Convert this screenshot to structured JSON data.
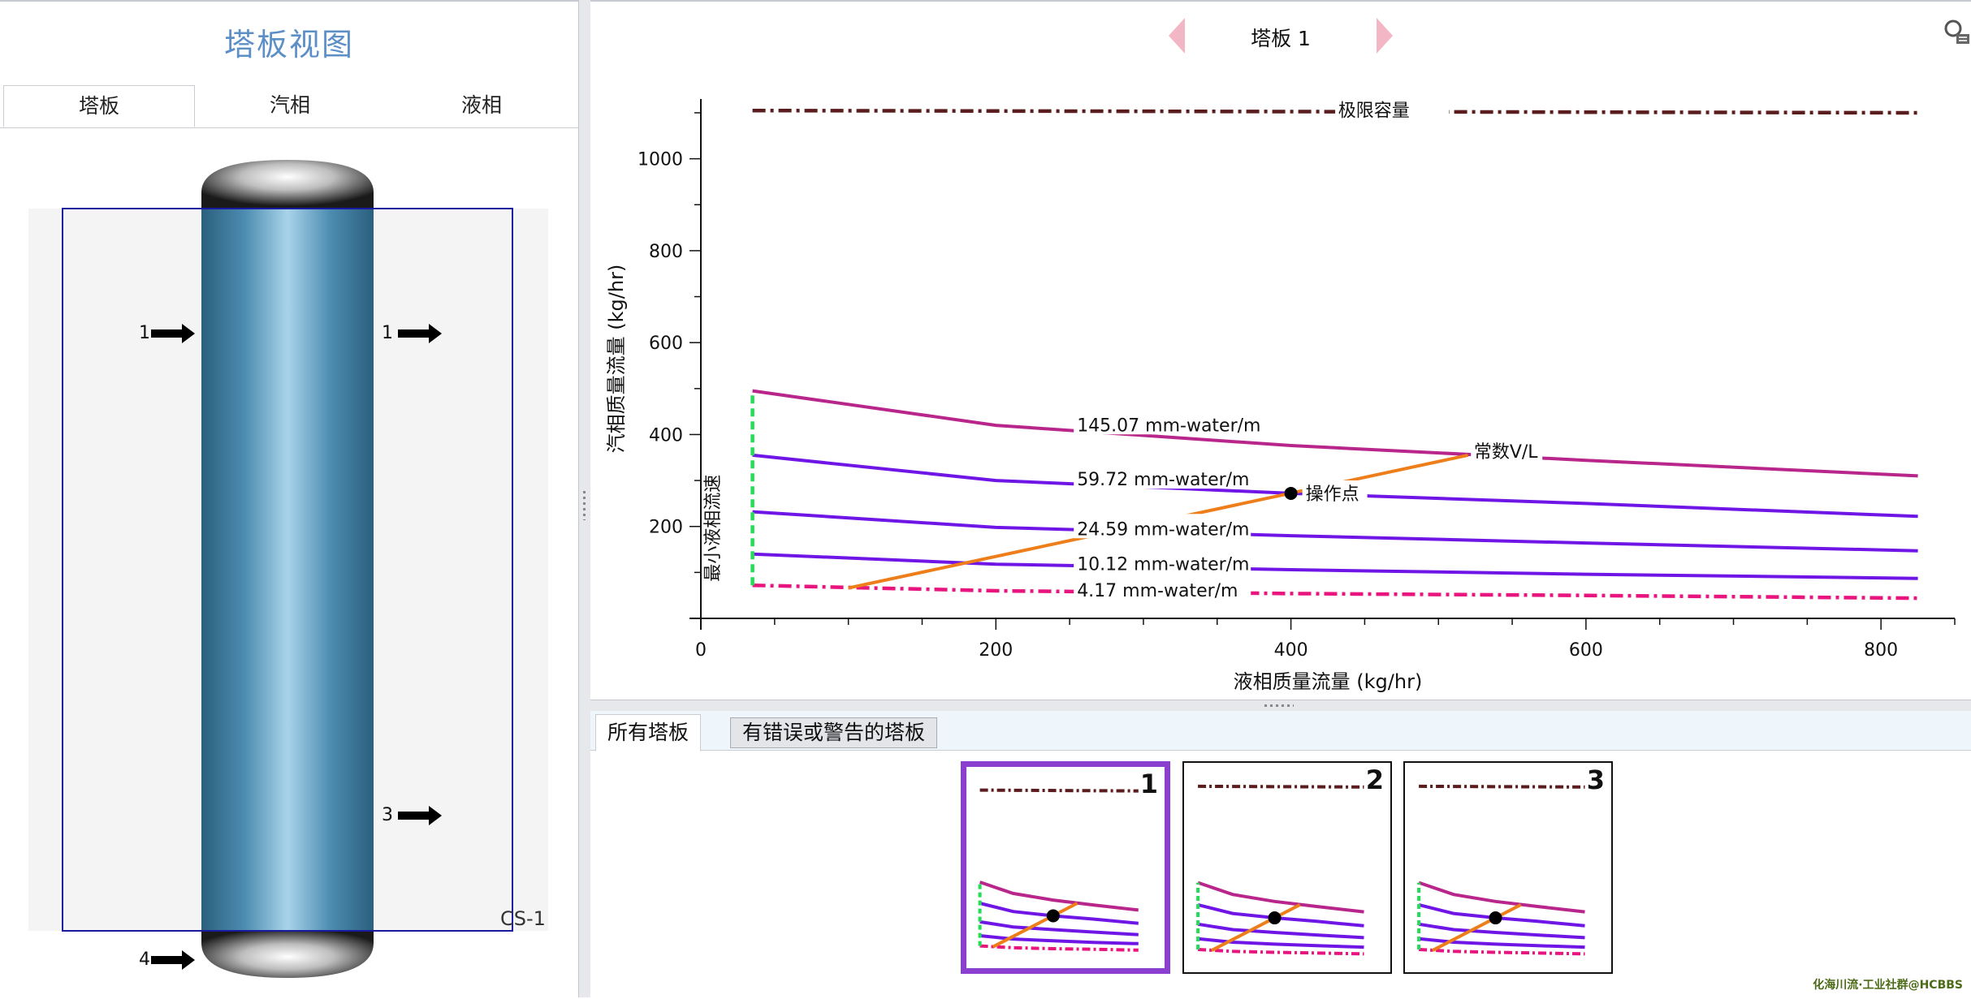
{
  "left_panel": {
    "title": "塔板视图",
    "tabs": [
      {
        "label": "塔板",
        "active": true
      },
      {
        "label": "汽相",
        "active": false
      },
      {
        "label": "液相",
        "active": false
      }
    ],
    "column_label": "CS-1",
    "streams": {
      "left_1": "1",
      "right_1": "1",
      "right_3": "3",
      "bottom_4": "4"
    }
  },
  "chart_header": {
    "tray_label": "塔板 1",
    "prev_icon": "chevron-left-icon",
    "next_icon": "chevron-right-icon",
    "corner_icon": "magnifier-settings-icon"
  },
  "chart_data": {
    "type": "line",
    "xlabel": "液相质量流量 (kg/hr)",
    "ylabel": "汽相质量流量 (kg/hr)",
    "xlim": [
      0,
      850
    ],
    "ylim": [
      0,
      1130
    ],
    "x_ticks": [
      "0",
      "200",
      "400",
      "600",
      "800"
    ],
    "y_ticks": [
      "200",
      "400",
      "600",
      "800",
      "1000"
    ],
    "annotations": {
      "limit_capacity": "极限容量",
      "min_liquid": "最小液相流速",
      "constant_vl": "常数V/L",
      "operating_point": "操作点"
    },
    "series": [
      {
        "name": "极限容量",
        "color": "#5a1c1c",
        "style": "dashdot",
        "x": [
          35,
          825
        ],
        "y": [
          1105,
          1100
        ]
      },
      {
        "name": "145.07 mm-water/m",
        "color": "#b8268c",
        "style": "solid",
        "x": [
          35,
          200,
          400,
          600,
          825
        ],
        "y": [
          495,
          420,
          376,
          344,
          310
        ]
      },
      {
        "name": "59.72 mm-water/m",
        "color": "#6f16e6",
        "style": "solid",
        "x": [
          35,
          200,
          400,
          600,
          825
        ],
        "y": [
          355,
          300,
          272,
          250,
          222
        ]
      },
      {
        "name": "24.59 mm-water/m",
        "color": "#6f16e6",
        "style": "solid",
        "x": [
          35,
          200,
          400,
          600,
          825
        ],
        "y": [
          232,
          198,
          180,
          164,
          147
        ]
      },
      {
        "name": "10.12 mm-water/m",
        "color": "#6f16e6",
        "style": "solid",
        "x": [
          35,
          200,
          400,
          600,
          825
        ],
        "y": [
          140,
          118,
          106,
          96,
          87
        ]
      },
      {
        "name": "4.17 mm-water/m",
        "color": "#e8157f",
        "style": "dashdot",
        "x": [
          35,
          200,
          400,
          600,
          825
        ],
        "y": [
          72,
          60,
          54,
          50,
          44
        ]
      },
      {
        "name": "最小液相流速",
        "color": "#22dd55",
        "style": "dashed",
        "x": [
          35,
          35
        ],
        "y": [
          72,
          495
        ]
      },
      {
        "name": "常数V/L",
        "color": "#ee7e1a",
        "style": "solid",
        "x": [
          100,
          520
        ],
        "y": [
          66,
          355
        ]
      }
    ],
    "curve_labels": [
      "145.07 mm-water/m",
      "59.72 mm-water/m",
      "24.59 mm-water/m",
      "10.12 mm-water/m",
      "4.17 mm-water/m"
    ],
    "operating_point": {
      "x": 400,
      "y": 272
    }
  },
  "bottom_panel": {
    "tabs": [
      {
        "label": "所有塔板",
        "active": true
      },
      {
        "label": "有错误或警告的塔板",
        "active": false
      }
    ],
    "thumbnails": [
      {
        "label": "1",
        "selected": true
      },
      {
        "label": "2",
        "selected": false
      },
      {
        "label": "3",
        "selected": false
      }
    ]
  },
  "watermark": "化海川流·工业社群@HCBBS"
}
